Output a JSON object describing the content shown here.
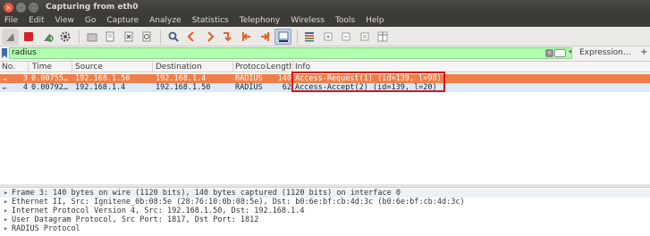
{
  "window": {
    "title": "Capturing from eth0",
    "close_glyph": "×",
    "min_glyph": "–",
    "max_glyph": "□"
  },
  "menu": [
    "File",
    "Edit",
    "View",
    "Go",
    "Capture",
    "Analyze",
    "Statistics",
    "Telephony",
    "Wireless",
    "Tools",
    "Help"
  ],
  "toolbar": {
    "icons": [
      "shark-fin-start-icon",
      "stop-square-icon",
      "restart-capture-icon",
      "capture-options-gear-icon",
      "open-file-icon",
      "save-file-icon",
      "close-file-icon",
      "reload-file-icon",
      "find-packet-icon",
      "go-back-icon",
      "go-forward-icon",
      "go-to-packet-icon",
      "go-to-first-icon",
      "go-to-last-icon",
      "autoscroll-icon",
      "colorize-icon",
      "zoom-in-icon",
      "zoom-out-icon",
      "normal-size-icon",
      "resize-columns-icon"
    ]
  },
  "filter": {
    "value": "radius",
    "clear_glyph": "×",
    "dropdown_glyph": "▾",
    "expression_label": "Expression…",
    "add_label": "+"
  },
  "columns": [
    "No.",
    "Time",
    "Source",
    "Destination",
    "Protoco",
    "Length",
    "Info"
  ],
  "packets": [
    {
      "no": "3",
      "time": "0.00755…",
      "source": "192.168.1.50",
      "destination": "192.168.1.4",
      "protocol": "RADIUS",
      "length": "140",
      "info": "Access-Request(1) (id=139, l=98)",
      "mark": "→"
    },
    {
      "no": "4",
      "time": "0.00792…",
      "source": "192.168.1.4",
      "destination": "192.168.1.50",
      "protocol": "RADIUS",
      "length": "62",
      "info": "Access-Accept(2) (id=139, l=20)",
      "mark": "←"
    }
  ],
  "details": [
    {
      "text": "Frame 3: 140 bytes on wire (1120 bits), 140 bytes captured (1120 bits) on interface 0"
    },
    {
      "text": "Ethernet II, Src: Ignitene_0b:08:5e (28:76:10:0b:08:5e), Dst: b0:6e:bf:cb:4d:3c (b0:6e:bf:cb:4d:3c)"
    },
    {
      "text": "Internet Protocol Version 4, Src: 192.168.1.50, Dst: 192.168.1.4"
    },
    {
      "text": "User Datagram Protocol, Src Port: 1817, Dst Port: 1812"
    },
    {
      "text": "RADIUS Protocol"
    }
  ],
  "colors": {
    "selected_row": "#ef7e48",
    "alt_row": "#dde9f7",
    "filter_ok": "#afffaf",
    "highlight_box": "#d4161d"
  }
}
